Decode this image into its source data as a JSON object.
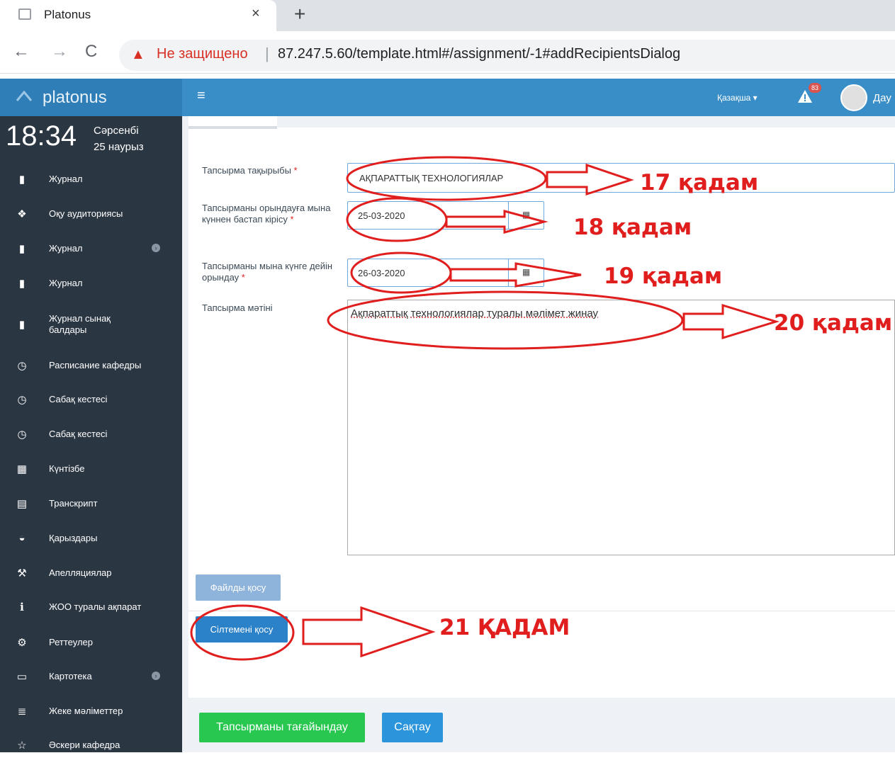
{
  "browser": {
    "tab_title": "Platonus",
    "tab_close": "×",
    "new_tab": "+",
    "nav_back": "←",
    "nav_forward": "→",
    "nav_reload": "C",
    "security_warning_icon": "▲",
    "security_warning": "Не защищено",
    "url_separator": "|",
    "url": "87.247.5.60/template.html#/assignment/-1#addRecipientsDialog"
  },
  "header": {
    "logo": "platonus",
    "menu_icon": "≡",
    "language": "Қазақша ▾",
    "notifications_count": "83",
    "user_name": "Дау"
  },
  "clock": {
    "time": "18:34",
    "day": "Сәрсенбі",
    "date": "25 наурыз"
  },
  "sidebar": {
    "items": [
      {
        "label": "Журнал",
        "icon": "book-icon"
      },
      {
        "label": "Оқу аудиториясы",
        "icon": "cubes-icon"
      },
      {
        "label": "Журнал",
        "icon": "book-icon",
        "has_submenu": true
      },
      {
        "label": "Журнал",
        "icon": "book-icon"
      },
      {
        "label": "Журнал сынақ балдары",
        "icon": "book-icon"
      },
      {
        "label": "Расписание кафедры",
        "icon": "clock-icon"
      },
      {
        "label": "Сабақ кестесі",
        "icon": "clock-icon"
      },
      {
        "label": "Сабақ кестесі",
        "icon": "clock-icon"
      },
      {
        "label": "Күнтізбе",
        "icon": "calendar-icon"
      },
      {
        "label": "Транскрипт",
        "icon": "table-icon"
      },
      {
        "label": "Қарыздары",
        "icon": "inbox-icon"
      },
      {
        "label": "Апелляциялар",
        "icon": "gavel-icon"
      },
      {
        "label": "ЖОО туралы ақпарат",
        "icon": "info-icon"
      },
      {
        "label": "Реттеулер",
        "icon": "gears-icon"
      },
      {
        "label": "Картотека",
        "icon": "folder-open-icon",
        "has_submenu": true
      },
      {
        "label": "Жеке мәліметтер",
        "icon": "list-icon"
      },
      {
        "label": "Әскери кафедра",
        "icon": "star-icon"
      }
    ]
  },
  "form": {
    "subject_label": "Тапсырма тақырыбы",
    "subject_value": "АҚПАРАТТЫҚ ТЕХНОЛОГИЯЛАР",
    "start_label": "Тапсырманы орындауға мына күннен бастап кірісу",
    "start_value": "25-03-2020",
    "end_label": "Тапсырманы мына күнге дейін орындау",
    "end_value": "26-03-2020",
    "text_label": "Тапсырма мәтіні",
    "text_value": "Ақпараттық технологиялар туралы мәлімет  жинау",
    "required_mark": "*",
    "calendar_icon": "▦"
  },
  "buttons": {
    "add_file": "Файлды қосу",
    "add_link": "Сілтемені қосу",
    "assign": "Тапсырманы тағайындау",
    "save": "Сақтау"
  },
  "annotations": {
    "step17": "17 қадам",
    "step18": "18 қадам",
    "step19": "19 қадам",
    "step20": "20 қадам",
    "step21": "21 ҚАДАМ"
  }
}
